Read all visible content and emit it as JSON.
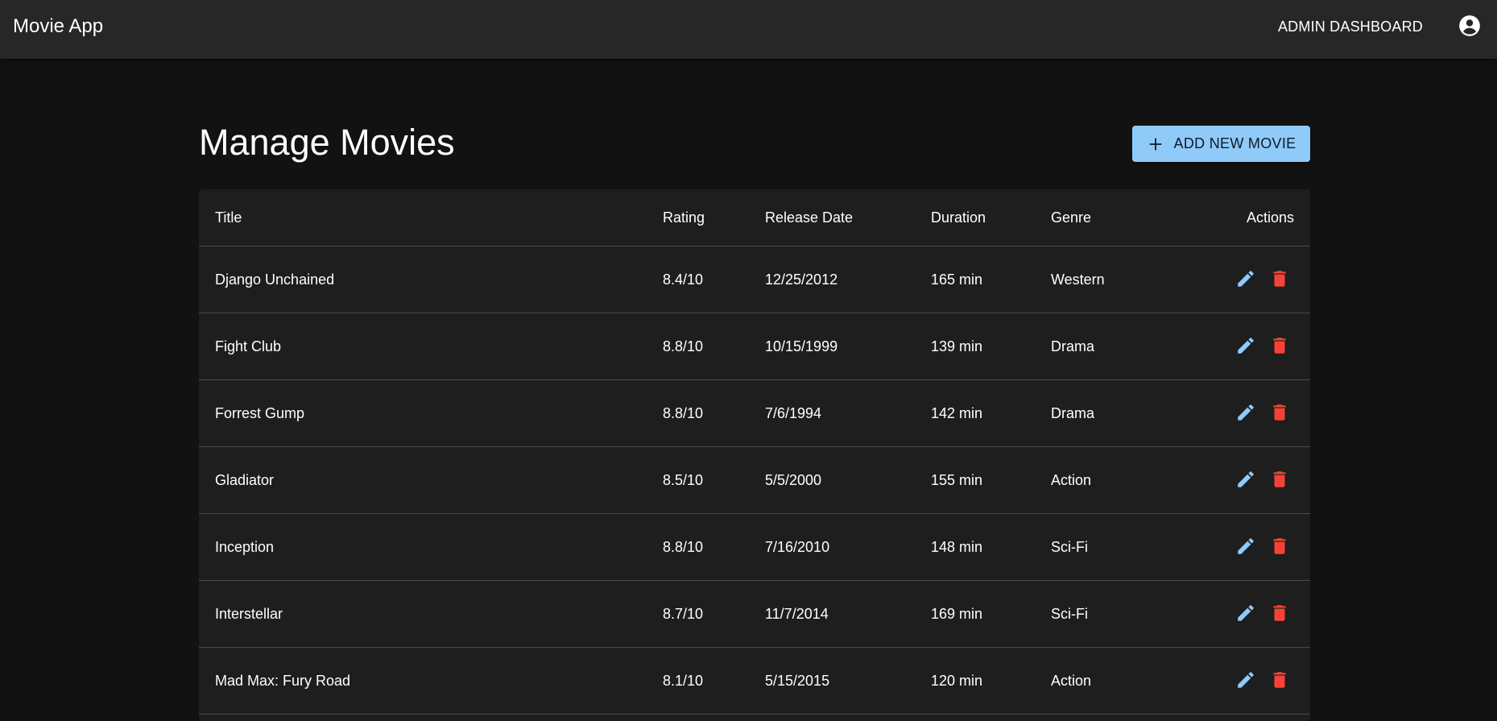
{
  "app": {
    "title": "Movie App",
    "nav_admin": "ADMIN DASHBOARD",
    "account_icon": "account-circle-icon"
  },
  "page": {
    "title": "Manage Movies",
    "add_button_label": "ADD NEW MOVIE"
  },
  "colors": {
    "appbar": "#272727",
    "background": "#121212",
    "panel": "#1e1e1e",
    "primary": "#90caf9",
    "danger": "#f44336"
  },
  "table": {
    "headers": {
      "title": "Title",
      "rating": "Rating",
      "release_date": "Release Date",
      "duration": "Duration",
      "genre": "Genre",
      "actions": "Actions"
    },
    "rows": [
      {
        "title": "Django Unchained",
        "rating": "8.4/10",
        "release_date": "12/25/2012",
        "duration": "165 min",
        "genre": "Western"
      },
      {
        "title": "Fight Club",
        "rating": "8.8/10",
        "release_date": "10/15/1999",
        "duration": "139 min",
        "genre": "Drama"
      },
      {
        "title": "Forrest Gump",
        "rating": "8.8/10",
        "release_date": "7/6/1994",
        "duration": "142 min",
        "genre": "Drama"
      },
      {
        "title": "Gladiator",
        "rating": "8.5/10",
        "release_date": "5/5/2000",
        "duration": "155 min",
        "genre": "Action"
      },
      {
        "title": "Inception",
        "rating": "8.8/10",
        "release_date": "7/16/2010",
        "duration": "148 min",
        "genre": "Sci-Fi"
      },
      {
        "title": "Interstellar",
        "rating": "8.7/10",
        "release_date": "11/7/2014",
        "duration": "169 min",
        "genre": "Sci-Fi"
      },
      {
        "title": "Mad Max: Fury Road",
        "rating": "8.1/10",
        "release_date": "5/15/2015",
        "duration": "120 min",
        "genre": "Action"
      }
    ],
    "action_icons": {
      "edit": "pencil-icon",
      "delete": "trash-icon"
    }
  }
}
